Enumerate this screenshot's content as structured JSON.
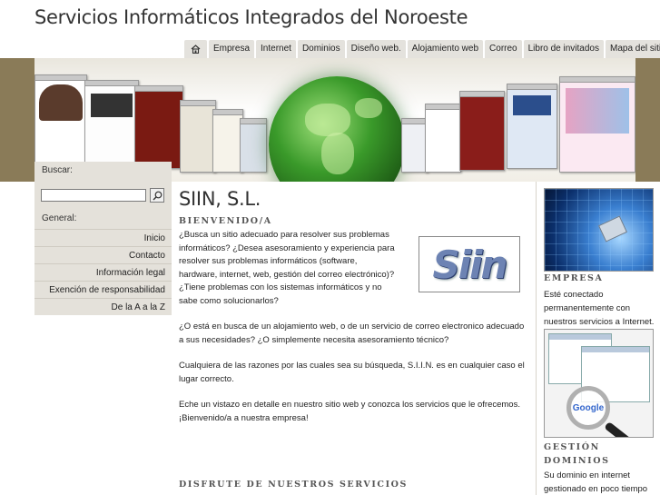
{
  "header": {
    "title": "Servicios Informáticos Integrados del Noroeste"
  },
  "topnav": {
    "home_icon": "home-icon",
    "items": [
      "Empresa",
      "Internet",
      "Dominios",
      "Diseño web.",
      "Alojamiento web",
      "Correo",
      "Libro de invitados",
      "Mapa del sitio"
    ]
  },
  "sidebar": {
    "search_label": "Buscar:",
    "search_value": "",
    "search_icon": "magnifier-icon",
    "general_label": "General:",
    "items": [
      "Inicio",
      "Contacto",
      "Información legal",
      "Exención de responsabilidad",
      "De la A a la Z"
    ]
  },
  "main": {
    "title": "SIIN, S.L.",
    "welcome_heading": "BIENVENIDO/A",
    "p1": "¿Busca un sitio adecuado para resolver sus problemas informáticos? ¿Desea asesoramiento y experiencia para resolver sus problemas informáticos (software, hardware, internet, web, gestión del correo electrónico)? ¿Tiene problemas con los sistemas informáticos y no sabe como solucionarlos?",
    "p2": "¿O está en busca de un alojamiento web, o de un servicio de correo electronico adecuado a sus necesidades? ¿O simplemente necesita asesoramiento técnico?",
    "p3": "Cualquiera de las razones por las cuales sea su búsqueda, S.I.I.N. es en cualquier caso el lugar correcto.",
    "p4": "Eche un vistazo en detalle en nuestro sitio web y conozca los servicios que le ofrecemos. ¡Bienvenido/a a nuestra empresa!",
    "logo_text": "Siin",
    "services_heading": "DISFRUTE DE NUESTROS SERVICIOS"
  },
  "right": {
    "block1_heading": "EMPRESA",
    "block1_text": "Esté conectado permanentemente con nuestros servicios a Internet.",
    "block2_heading": "GESTIÓN DOMINIOS",
    "block2_text": "Su dominio en internet gestionado en poco tiempo",
    "google_label": "Google"
  },
  "colors": {
    "banner_frame": "#8a7b58",
    "sidebar_bg": "#e4e1da",
    "tab_bg": "#e4e2dd"
  }
}
